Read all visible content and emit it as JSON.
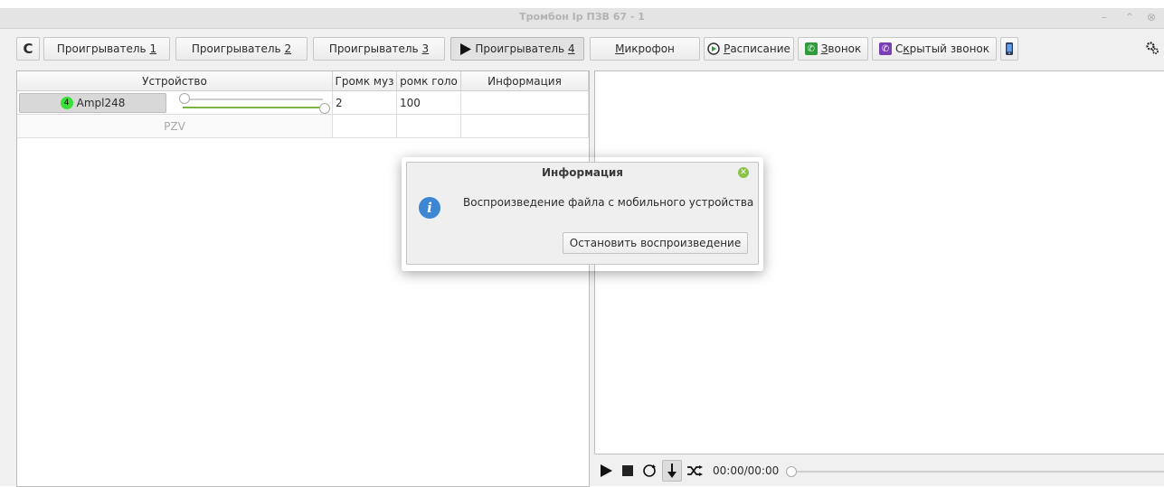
{
  "window": {
    "title": "Тромбон Ip ПЗВ 67 - 1",
    "minimize": "–",
    "maximize": "⌃",
    "close": "⊗"
  },
  "toolbar": {
    "refresh_glyph": "C",
    "tabs": [
      {
        "label_pre": "Проигрыватель ",
        "label_key": "1"
      },
      {
        "label_pre": "Проигрыватель ",
        "label_key": "2"
      },
      {
        "label_pre": "Проигрыватель ",
        "label_key": "3"
      },
      {
        "label_pre": "Проигрыватель ",
        "label_key": "4"
      }
    ],
    "mic": {
      "label_key": "М",
      "label_rest": "икрофон"
    },
    "schedule": {
      "label_key": "Р",
      "label_rest": "асписание"
    },
    "call": {
      "label_key": "З",
      "label_rest": "вонок"
    },
    "hidden_call": {
      "label_pre": "С",
      "label_key": "к",
      "label_rest": "рытый звонок"
    }
  },
  "table": {
    "headers": [
      "Устройство",
      "Громк муз",
      "ромк голо",
      "Информация"
    ],
    "rows": [
      {
        "badge": "4",
        "device": "Ampl248",
        "music_volume": "2",
        "voice_volume": "100",
        "info": "",
        "slider_value": 0.0,
        "slider_max": 1.0
      },
      {
        "device": "PZV",
        "music_volume": "",
        "voice_volume": "",
        "info": ""
      }
    ]
  },
  "player": {
    "time": "00:00/00:00",
    "progress": 0
  },
  "dialog": {
    "title": "Информация",
    "message": "Воспроизведение файла с мобильного устройства",
    "button": "Остановить воспроизведение"
  },
  "colors": {
    "accent_green": "#38e038",
    "info_blue": "#3d86d4",
    "call_green": "#2e9a3a",
    "hidden_call_purple": "#7a3fb5"
  }
}
